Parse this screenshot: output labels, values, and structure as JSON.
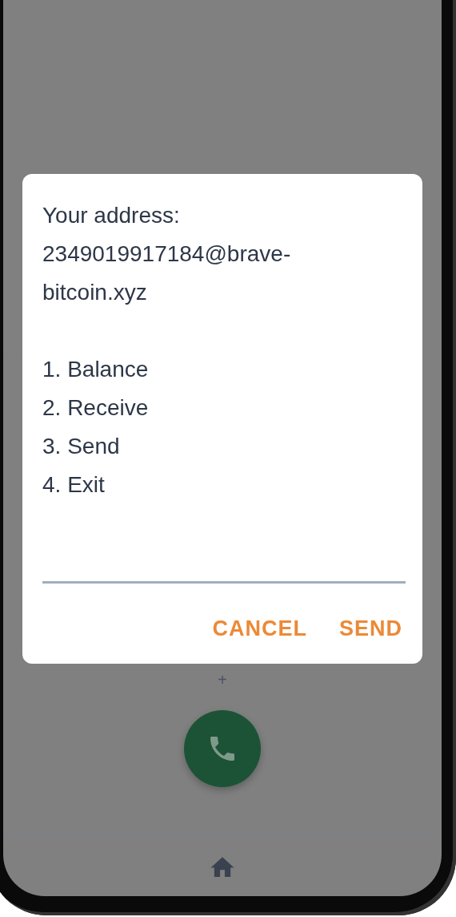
{
  "background": {
    "keypad_key": "+"
  },
  "dialog": {
    "address_label": "Your address:",
    "address": "2349019917184@brave-bitcoin.xyz",
    "menu": [
      "1. Balance",
      "2. Receive",
      "3. Send",
      "4. Exit"
    ],
    "buttons": [
      "CANCEL",
      "SEND"
    ]
  }
}
